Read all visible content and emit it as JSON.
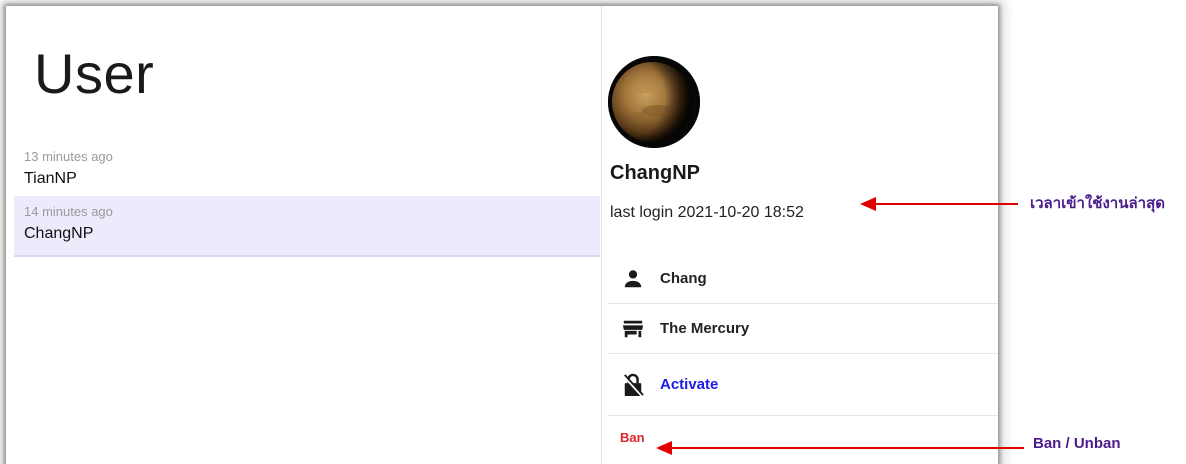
{
  "page": {
    "title": "User"
  },
  "users": [
    {
      "time": "13 minutes ago",
      "name": "TianNP",
      "selected": false
    },
    {
      "time": "14 minutes ago",
      "name": "ChangNP",
      "selected": true
    }
  ],
  "profile": {
    "name": "ChangNP",
    "last_login": "last login 2021-10-20 18:52",
    "info": [
      {
        "icon": "person-icon",
        "text": "Chang"
      },
      {
        "icon": "store-icon",
        "text": "The Mercury"
      },
      {
        "icon": "lock-off-icon",
        "text": "Activate"
      }
    ],
    "ban_label": "Ban"
  },
  "annotations": {
    "last_login_note": "เวลาเข้าใช้งานล่าสุด",
    "ban_note": "Ban / Unban"
  },
  "colors": {
    "selected_row": "#eeeafc",
    "link": "#1a1ae6",
    "ban": "#e0252b",
    "annotation_arrow": "#e00000",
    "annotation_text": "#4b1c8c"
  }
}
